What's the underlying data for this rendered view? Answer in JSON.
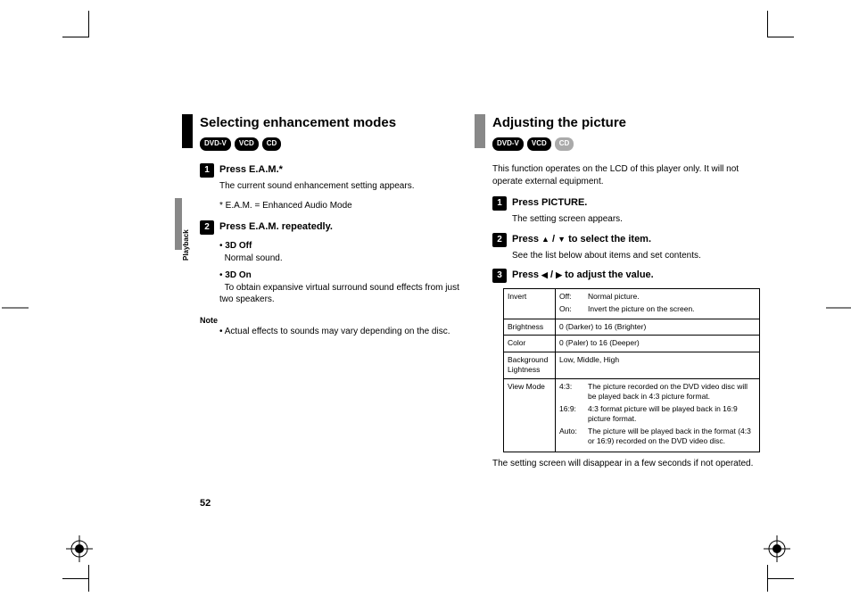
{
  "page_number": "52",
  "side_label": "Playback",
  "left": {
    "title": "Selecting enhancement modes",
    "badges": [
      "DVD-V",
      "VCD",
      "CD"
    ],
    "step1": {
      "title": "Press E.A.M.*",
      "body": "The current sound enhancement setting appears.",
      "foot": "* E.A.M. = Enhanced Audio Mode"
    },
    "step2": {
      "title": "Press E.A.M. repeatedly.",
      "opt1_t": "3D Off",
      "opt1_b": "Normal sound.",
      "opt2_t": "3D On",
      "opt2_b": "To obtain expansive virtual surround sound effects from just two speakers."
    },
    "note_h": "Note",
    "note_b": "Actual effects to sounds may vary depending on the disc."
  },
  "right": {
    "title": "Adjusting the picture",
    "badges": [
      "DVD-V",
      "VCD",
      "CD"
    ],
    "intro": "This function operates on the LCD of this player only. It will not operate external equipment.",
    "step1": {
      "title": "Press PICTURE.",
      "body": "The setting screen appears."
    },
    "step2": {
      "title_pre": "Press ",
      "title_post": " to select the item.",
      "body": "See the list below about items and set contents."
    },
    "step3": {
      "title_pre": "Press ",
      "title_post": " to adjust the value."
    },
    "table": {
      "r1k": "Invert",
      "r1a": "Off:",
      "r1av": "Normal picture.",
      "r1b": "On:",
      "r1bv": "Invert the picture on the screen.",
      "r2k": "Brightness",
      "r2v": "0 (Darker) to 16 (Brighter)",
      "r3k": "Color",
      "r3v": "0 (Paler) to 16 (Deeper)",
      "r4k": "Background Lightness",
      "r4v": "Low, Middle, High",
      "r5k": "View Mode",
      "r5a": "4:3:",
      "r5av": "The picture recorded on the DVD video disc will be played back in 4:3 picture format.",
      "r5b": "16:9:",
      "r5bv": "4:3 format picture will be played back in 16:9 picture format.",
      "r5c": "Auto:",
      "r5cv": "The picture will be played back in the format (4:3 or 16:9) recorded on the DVD video disc."
    },
    "outro": "The setting screen will disappear in a few seconds if not operated."
  }
}
